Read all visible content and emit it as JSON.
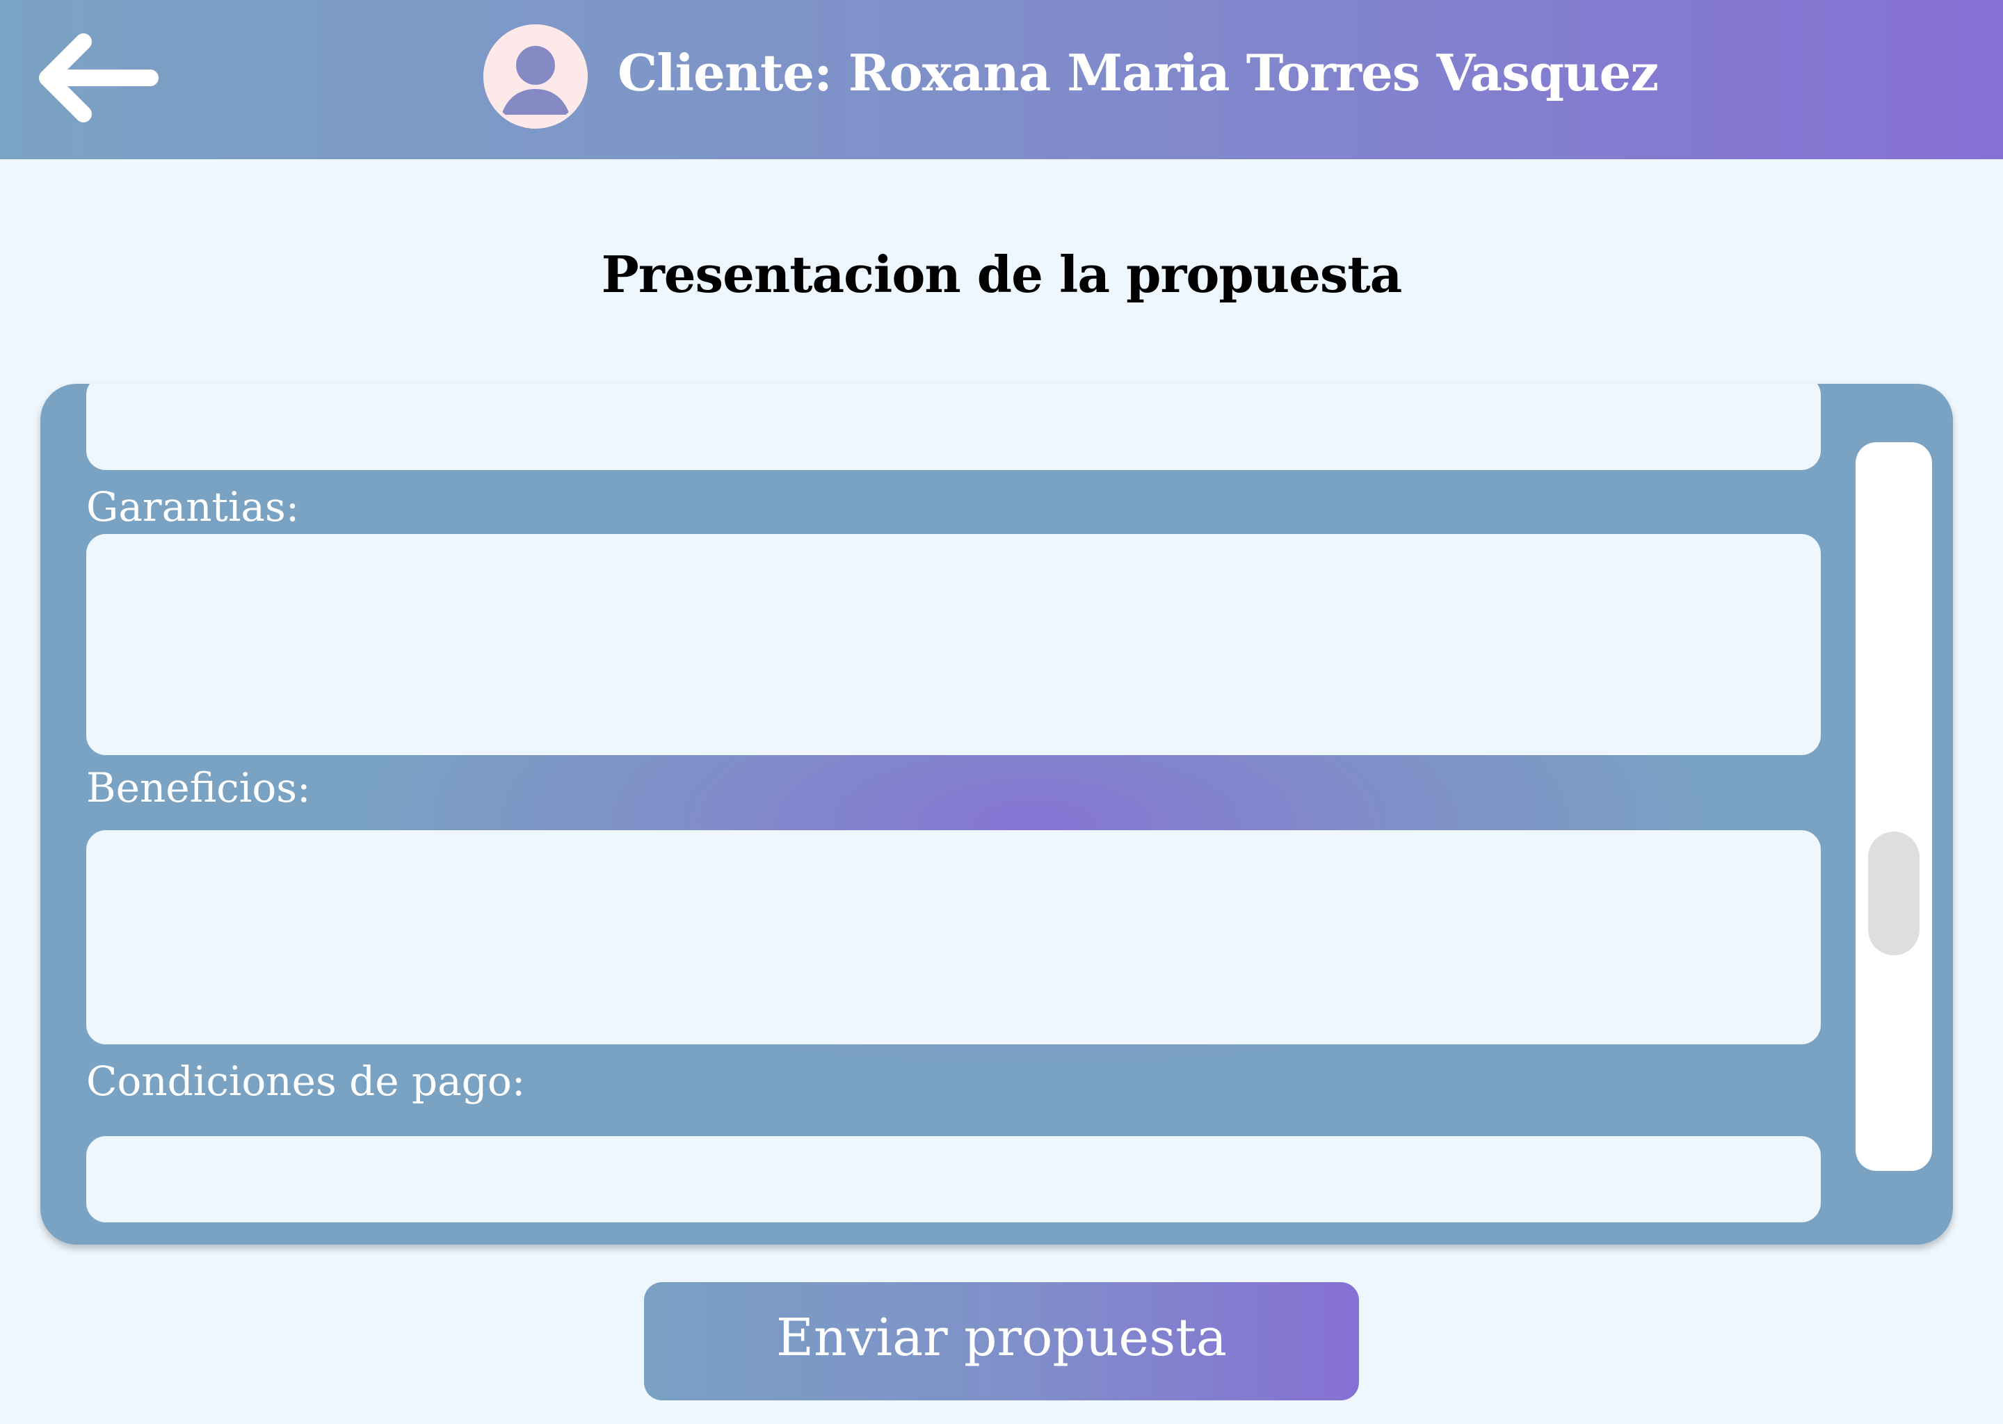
{
  "header": {
    "back_icon": "arrow-left-icon",
    "avatar_icon": "user-avatar-icon",
    "title": "Cliente: Roxana Maria Torres Vasquez"
  },
  "page_title": "Presentacion de la propuesta",
  "form": {
    "fields": [
      {
        "label": "",
        "value": ""
      },
      {
        "label": "Garantias:",
        "value": ""
      },
      {
        "label": "Beneficios:",
        "value": ""
      },
      {
        "label": "Condiciones de pago:",
        "value": ""
      }
    ]
  },
  "submit_label": "Enviar propuesta",
  "colors": {
    "page_background": "#eef7fd",
    "gradient_start": "#7ba3c4",
    "gradient_end": "#8670d4",
    "field_background": "#eef7fd",
    "avatar_background": "#fde8ea"
  }
}
